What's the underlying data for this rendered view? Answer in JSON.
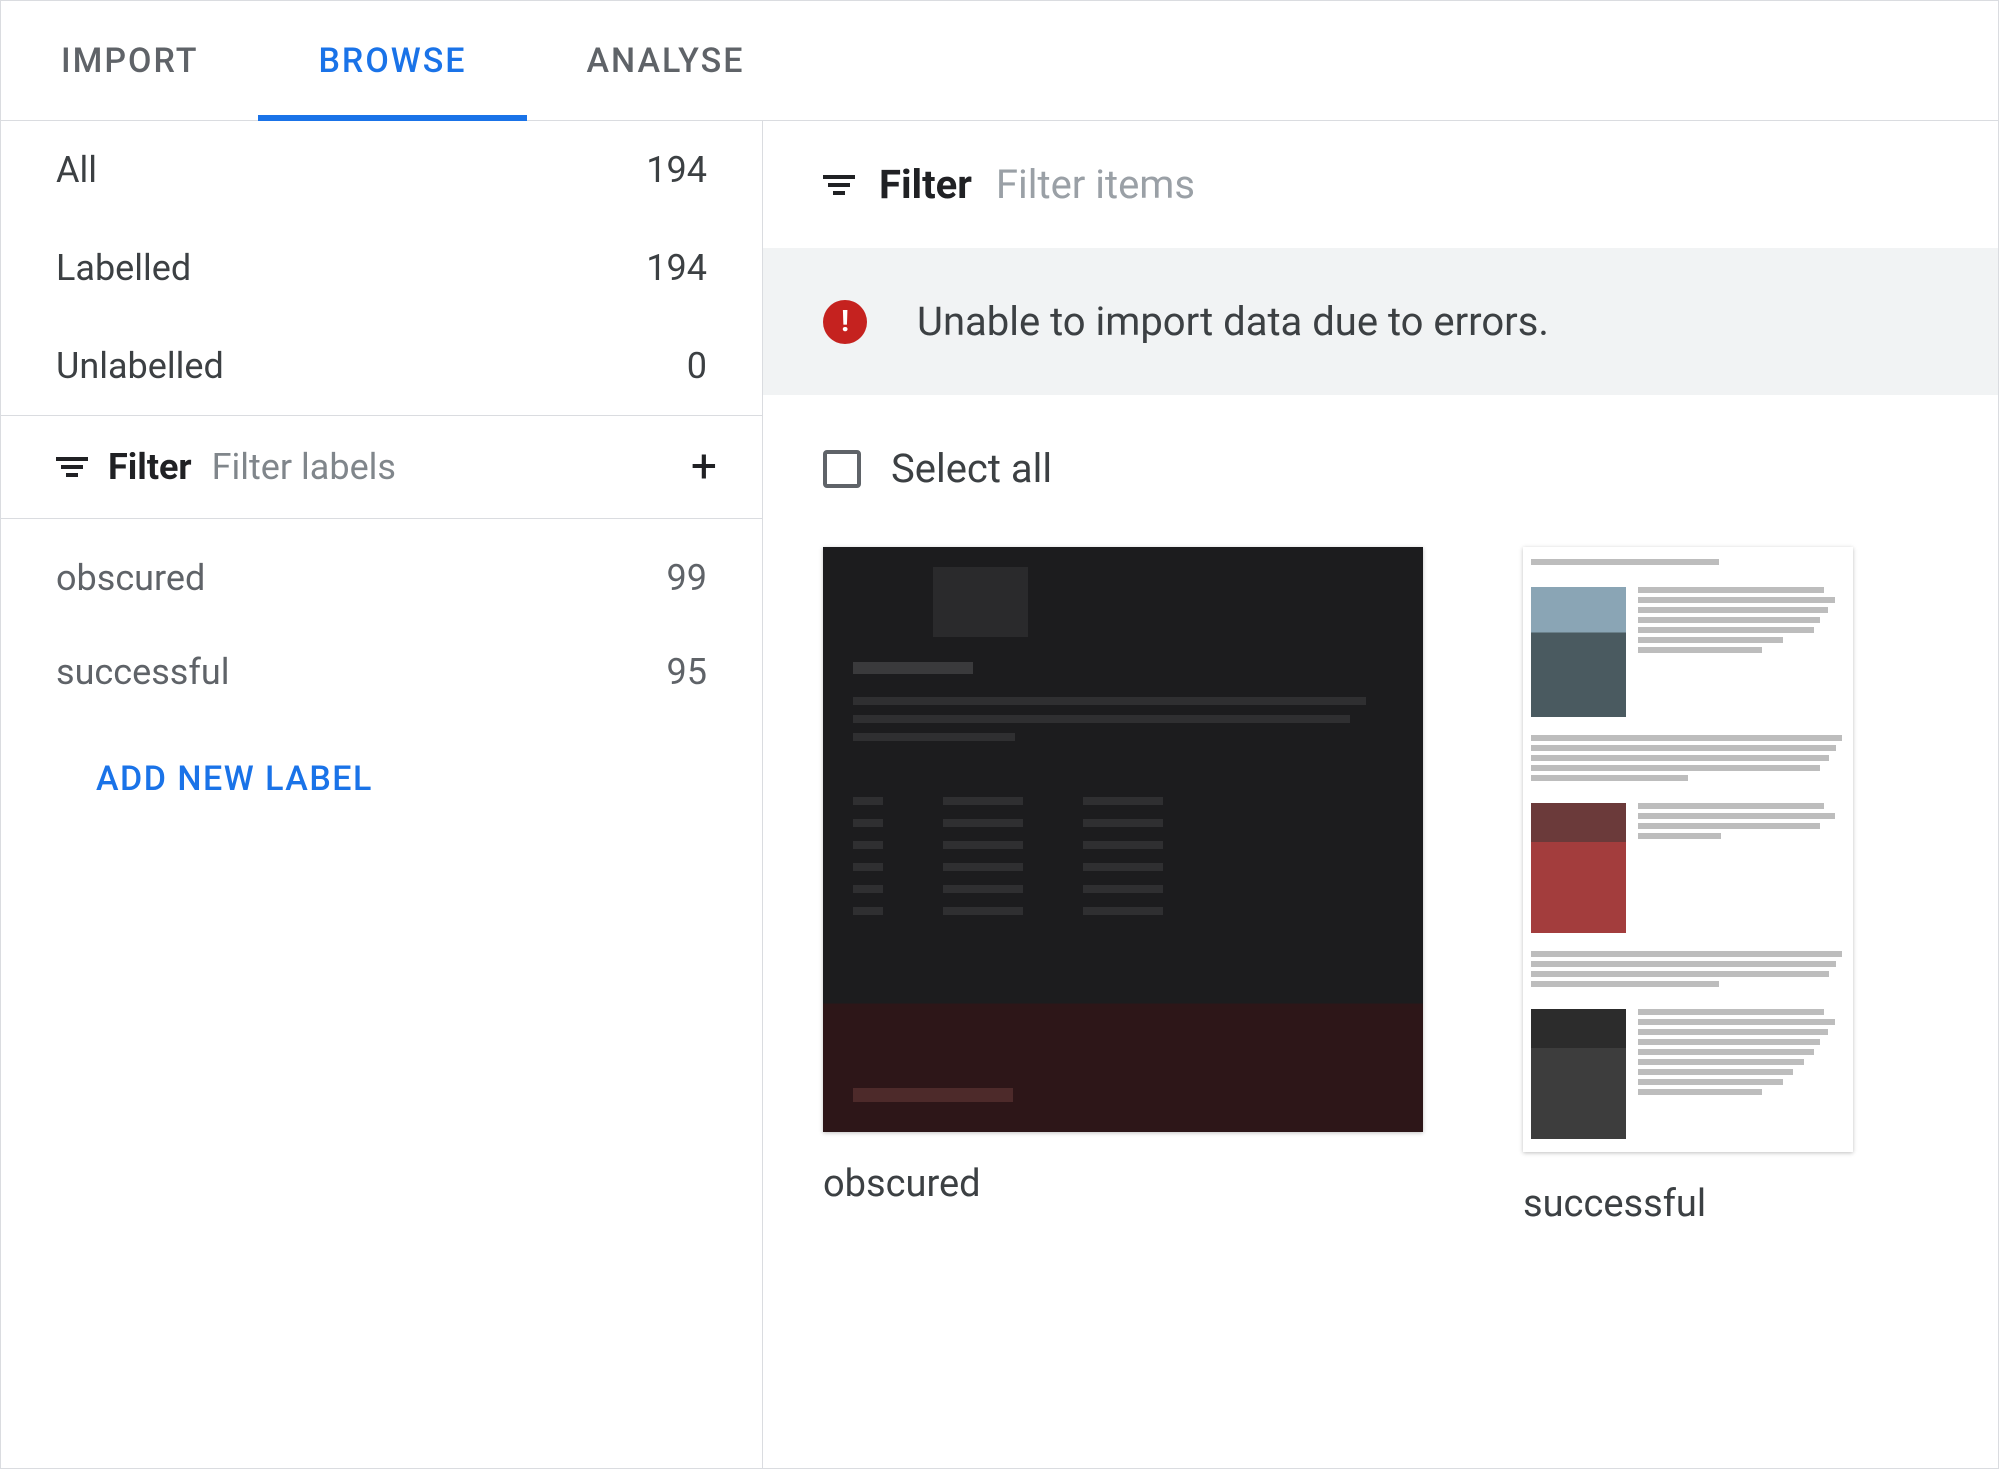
{
  "tabs": {
    "import": "IMPORT",
    "browse": "BROWSE",
    "analyse": "ANALYSE",
    "active": "browse"
  },
  "sidebar": {
    "stats": [
      {
        "label": "All",
        "count": "194"
      },
      {
        "label": "Labelled",
        "count": "194"
      },
      {
        "label": "Unlabelled",
        "count": "0"
      }
    ],
    "filter": {
      "label": "Filter",
      "placeholder": "Filter labels"
    },
    "labels": [
      {
        "name": "obscured",
        "count": "99"
      },
      {
        "name": "successful",
        "count": "95"
      }
    ],
    "add_label": "ADD NEW LABEL"
  },
  "content": {
    "filter": {
      "label": "Filter",
      "placeholder": "Filter items"
    },
    "error": "Unable to import data due to errors.",
    "select_all": "Select all",
    "cards": [
      {
        "label": "obscured"
      },
      {
        "label": "successful"
      }
    ]
  }
}
